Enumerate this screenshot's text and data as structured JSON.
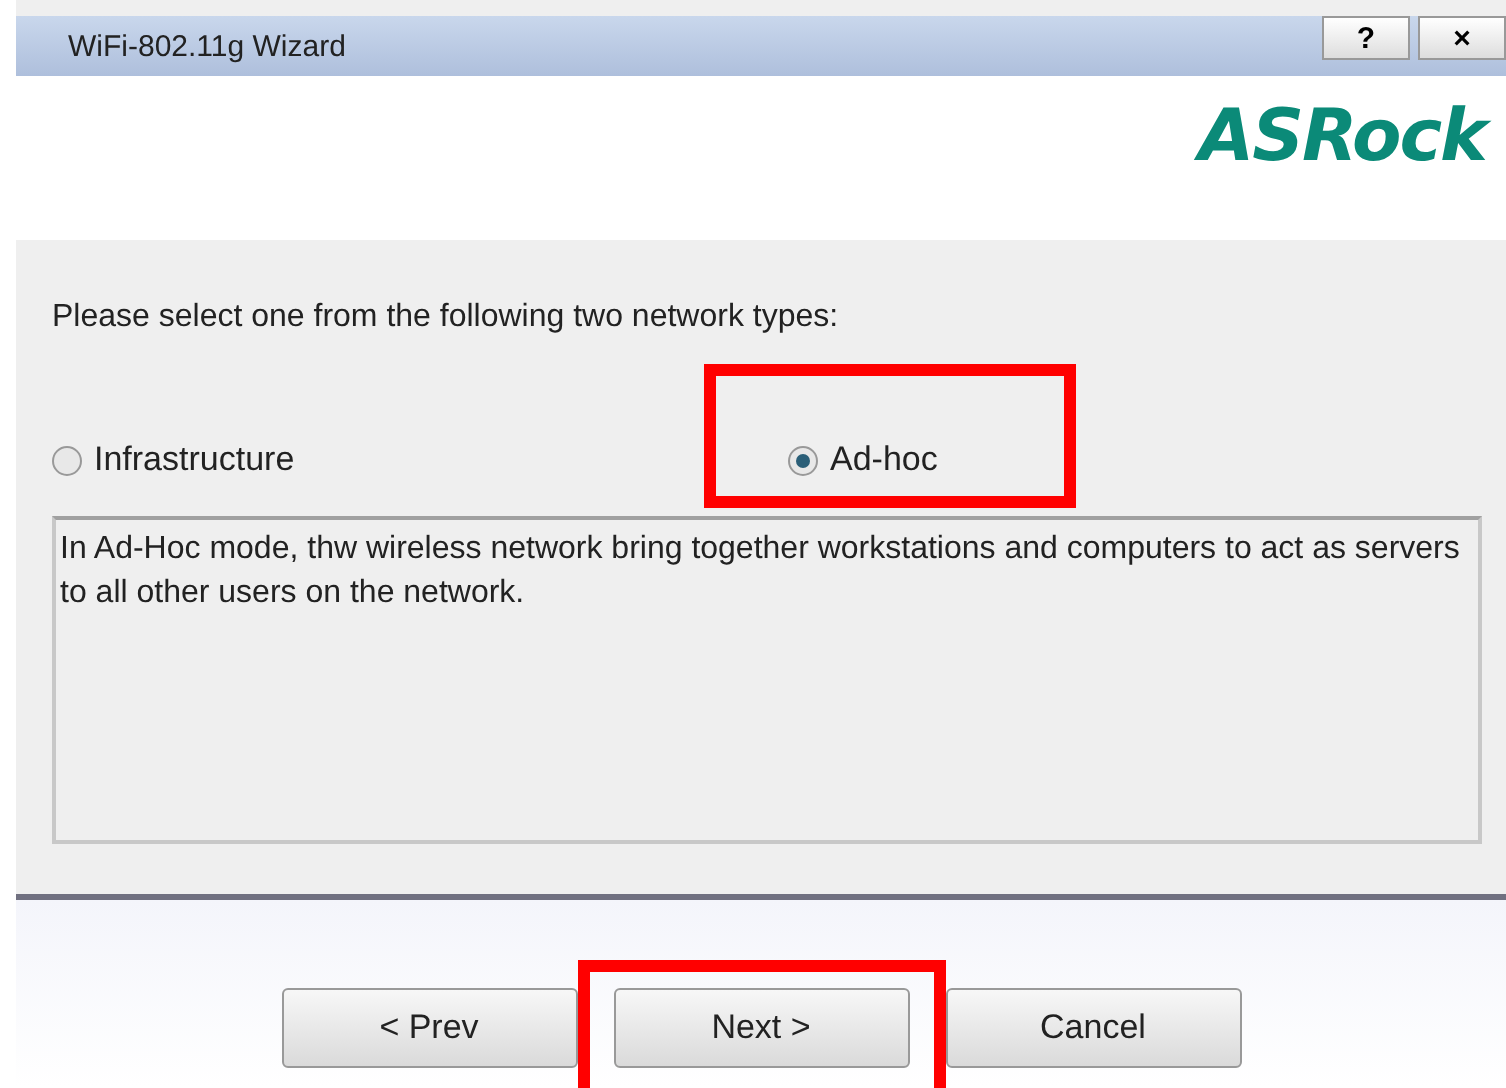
{
  "window": {
    "title": "WiFi-802.11g Wizard",
    "title_buttons": [
      "?",
      "×"
    ]
  },
  "header": {
    "logo": "ASRock"
  },
  "prompt": "Please select one from the following two network types:",
  "options": [
    {
      "label": "Infrastructure",
      "selected": false,
      "highlighted": false
    },
    {
      "label": "Ad-hoc",
      "selected": true,
      "highlighted": true
    }
  ],
  "description": "In Ad-Hoc mode, thw wireless network bring together workstations and computers to act as servers to all other users on the network.",
  "buttons": [
    {
      "label": "< Prev",
      "highlighted": false
    },
    {
      "label": "Next >",
      "highlighted": true
    },
    {
      "label": "Cancel",
      "highlighted": false
    }
  ]
}
